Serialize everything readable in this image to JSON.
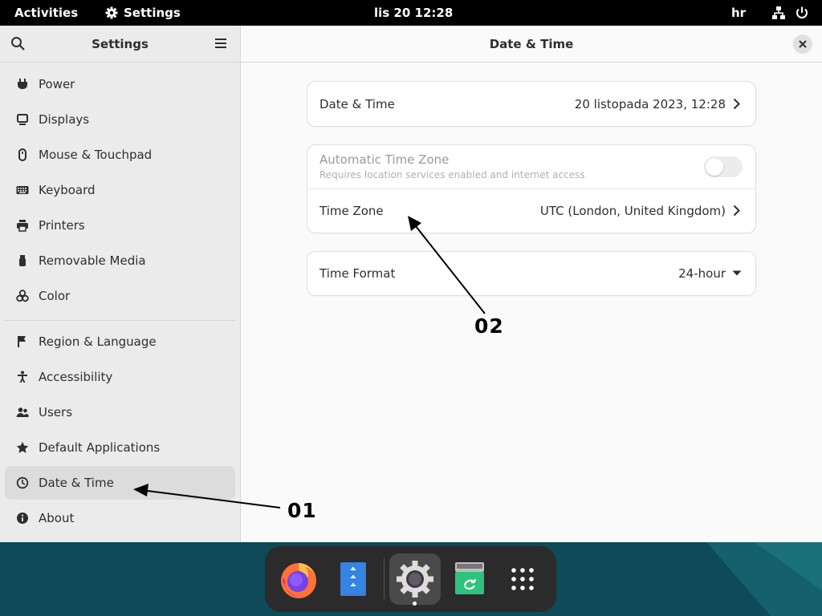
{
  "topbar": {
    "activities": "Activities",
    "app_name": "Settings",
    "clock": "lis 20 12:28",
    "keyboard_layout": "hr"
  },
  "sidebar": {
    "title": "Settings",
    "items": [
      {
        "label": "Power",
        "icon": "power-plug-icon"
      },
      {
        "label": "Displays",
        "icon": "display-icon"
      },
      {
        "label": "Mouse & Touchpad",
        "icon": "mouse-icon"
      },
      {
        "label": "Keyboard",
        "icon": "keyboard-icon"
      },
      {
        "label": "Printers",
        "icon": "printer-icon"
      },
      {
        "label": "Removable Media",
        "icon": "usb-icon"
      },
      {
        "label": "Color",
        "icon": "color-icon"
      },
      {
        "label": "Region & Language",
        "icon": "flag-icon"
      },
      {
        "label": "Accessibility",
        "icon": "accessibility-icon"
      },
      {
        "label": "Users",
        "icon": "users-icon"
      },
      {
        "label": "Default Applications",
        "icon": "star-icon"
      },
      {
        "label": "Date & Time",
        "icon": "clock-icon",
        "selected": true
      },
      {
        "label": "About",
        "icon": "info-icon"
      }
    ]
  },
  "content": {
    "title": "Date & Time",
    "date_time": {
      "label": "Date & Time",
      "value": "20 listopada 2023, 12:28"
    },
    "auto_timezone": {
      "label": "Automatic Time Zone",
      "subtitle": "Requires location services enabled and internet access",
      "enabled": false
    },
    "timezone": {
      "label": "Time Zone",
      "value": "UTC (London, United Kingdom)"
    },
    "time_format": {
      "label": "Time Format",
      "value": "24-hour"
    }
  },
  "annotations": {
    "a1": "01",
    "a2": "02"
  },
  "dock": {
    "items": [
      "firefox-icon",
      "files-icon",
      "settings-icon",
      "software-icon",
      "app-grid-icon"
    ]
  },
  "colors": {
    "accent_arrow": "#000000",
    "desktop": "#0e4a57",
    "dock": "#2b2b2b"
  }
}
